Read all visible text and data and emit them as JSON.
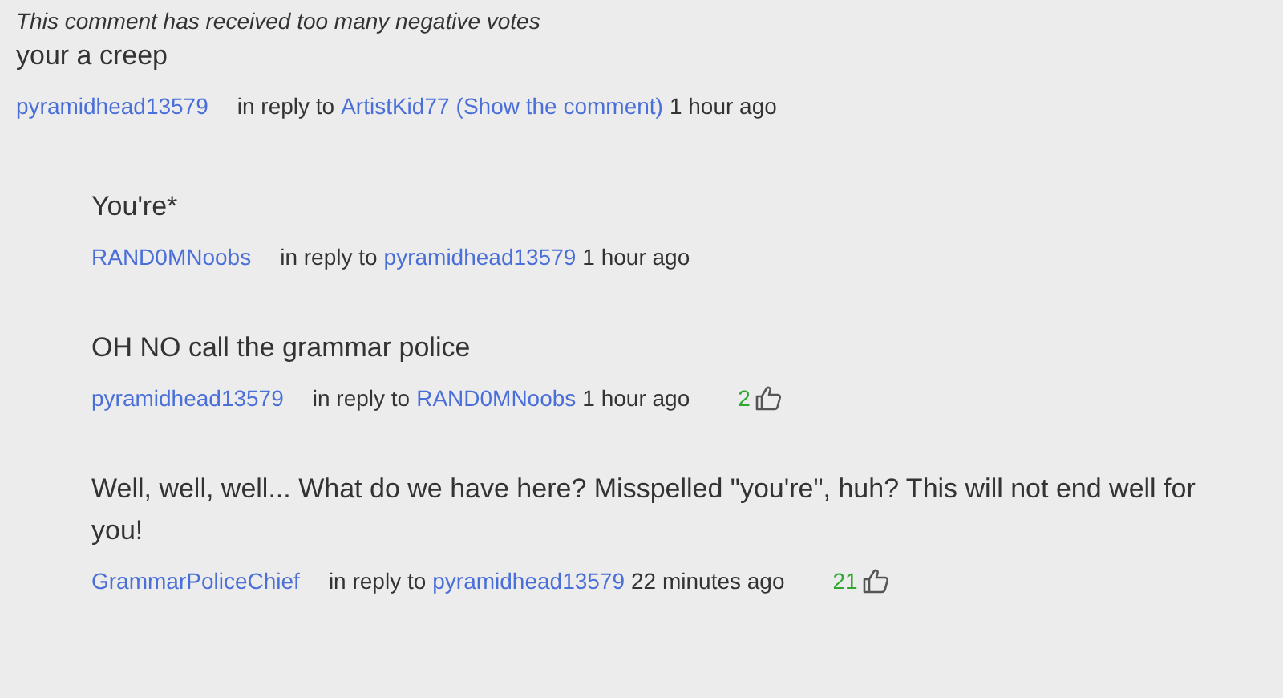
{
  "comments": [
    {
      "notice": "This comment has received too many negative votes",
      "text": "your a creep",
      "author": "pyramidhead13579",
      "reply_label": "in reply to",
      "reply_to": "ArtistKid77",
      "show_link": "(Show the comment)",
      "time": "1 hour ago",
      "children": [
        {
          "text": "You're*",
          "author": "RAND0MNoobs",
          "reply_label": "in reply to",
          "reply_to": "pyramidhead13579",
          "time": "1 hour ago"
        },
        {
          "text": "OH NO call the grammar police",
          "author": "pyramidhead13579",
          "reply_label": "in reply to",
          "reply_to": "RAND0MNoobs",
          "time": "1 hour ago",
          "likes": "2"
        },
        {
          "text": "Well, well, well... What do we have here? Misspelled \"you're\", huh? This will not end well for you!",
          "author": "GrammarPoliceChief",
          "reply_label": "in reply to",
          "reply_to": "pyramidhead13579",
          "time": "22 minutes ago",
          "likes": "21"
        }
      ]
    }
  ]
}
